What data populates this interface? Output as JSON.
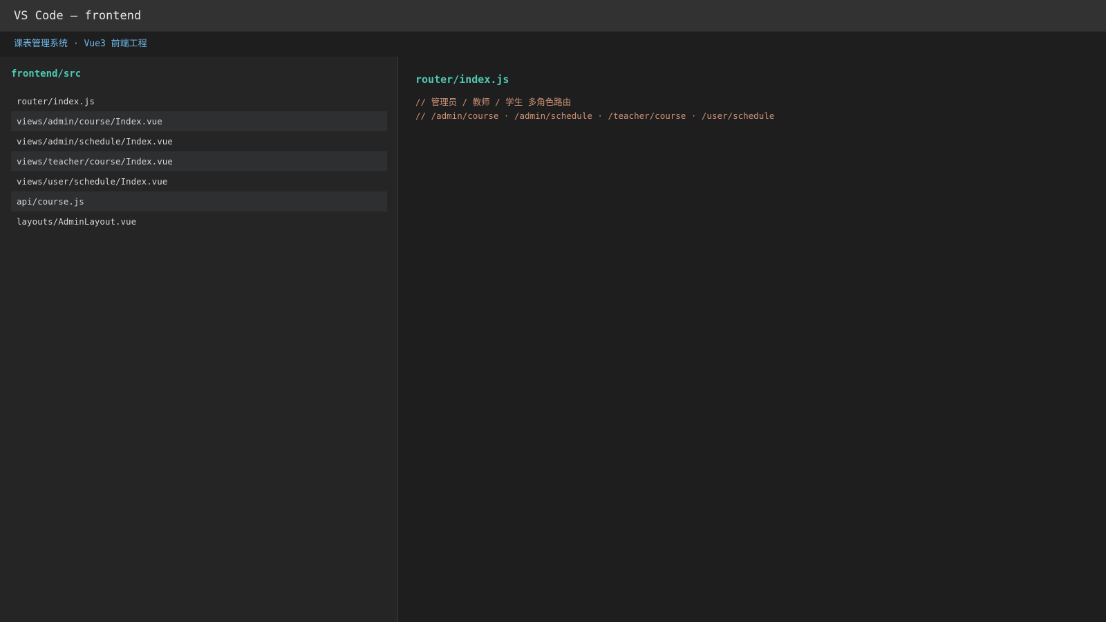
{
  "window": {
    "title": "VS Code — frontend"
  },
  "project": {
    "subtitle": "课表管理系统 · Vue3 前端工程"
  },
  "explorer": {
    "root": "frontend/src",
    "files": [
      "router/index.js",
      "views/admin/course/Index.vue",
      "views/admin/schedule/Index.vue",
      "views/teacher/course/Index.vue",
      "views/user/schedule/Index.vue",
      "api/course.js",
      "layouts/AdminLayout.vue"
    ]
  },
  "editor": {
    "filename": "router/index.js",
    "lines": [
      "// 管理员 / 教师 / 学生 多角色路由",
      "// /admin/course · /admin/schedule · /teacher/course · /user/schedule"
    ]
  },
  "colors": {
    "accent": "#4ec9b0",
    "subheader": "#6fb8e8",
    "comment": "#ce9178"
  }
}
